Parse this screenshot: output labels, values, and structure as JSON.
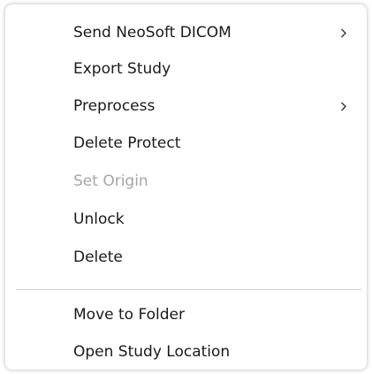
{
  "context_menu": {
    "items": [
      {
        "label": "Send NeoSoft DICOM",
        "submenu": true,
        "disabled": false
      },
      {
        "label": "Export Study",
        "submenu": false,
        "disabled": false
      },
      {
        "label": "Preprocess",
        "submenu": true,
        "disabled": false
      },
      {
        "label": "Delete Protect",
        "submenu": false,
        "disabled": false
      },
      {
        "label": "Set Origin",
        "submenu": false,
        "disabled": true
      },
      {
        "label": "Unlock",
        "submenu": false,
        "disabled": false
      },
      {
        "label": "Delete",
        "submenu": false,
        "disabled": false
      },
      {
        "label": "Move to Folder",
        "submenu": false,
        "disabled": false
      },
      {
        "label": "Open Study Location",
        "submenu": false,
        "disabled": false
      }
    ]
  },
  "colors": {
    "text": "#1a1a1a",
    "disabled_text": "#a6a6a6",
    "separator": "#d6d6d6",
    "background": "#ffffff"
  },
  "icons": {
    "submenu": "chevron-right-icon"
  }
}
